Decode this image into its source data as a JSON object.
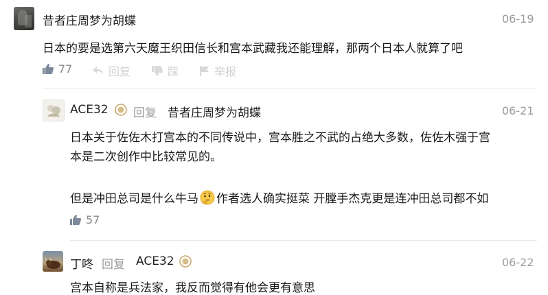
{
  "comments": [
    {
      "author": "昔者庄周梦为胡蝶",
      "date": "06-19",
      "text": "日本的要是选第六天魔王织田信长和宫本武藏我还能理解，那两个日本人就算了吧",
      "likes": "77",
      "actions": [
        "回复",
        "踩",
        "举报"
      ]
    },
    {
      "author": "ACE32",
      "reply_label": "回复",
      "reply_to": "昔者庄周梦为胡蝶",
      "date": "06-21",
      "text_line1": "日本关于佐佐木打宫本的不同传说中，宫本胜之不武的占绝大多数，佐佐木强于宫",
      "text_line2": "本是二次创作中比较常见的。",
      "text_line3a": "但是冲田总司是什么牛马",
      "text_line3b": "作者选人确实挺菜 开膛手杰克更是连冲田总司都不如",
      "likes": "57"
    },
    {
      "author": "丁咚",
      "reply_label": "回复",
      "reply_to": "ACE32",
      "date": "06-22",
      "text": "宫本自称是兵法家，我反而觉得有他会更有意思"
    }
  ],
  "icons": {
    "like": "thumbs-up-icon",
    "reply": "reply-arrow-icon",
    "dislike": "thumbs-down-icon",
    "report": "flag-icon",
    "badge": "level-badge-icon",
    "emoji": "thinking-emoji-icon"
  },
  "colors": {
    "text": "#1a1a1a",
    "muted": "#9a9a9a",
    "badge": "#c9a86a",
    "divider": "#e9e9e9"
  }
}
